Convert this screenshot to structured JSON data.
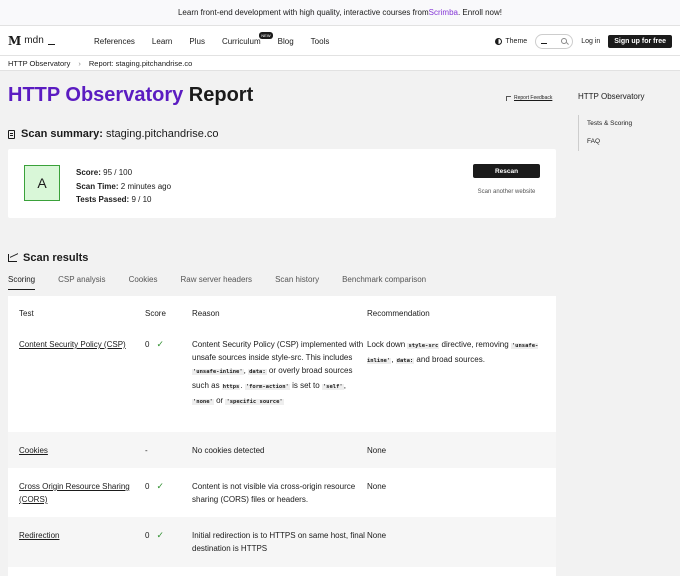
{
  "banner": {
    "prefix": "Learn front-end development with high quality, interactive courses from ",
    "link": "Scrimba",
    "suffix": ". Enroll now!"
  },
  "nav": {
    "logo": {
      "mark": "M",
      "text": "mdn"
    },
    "items": [
      "References",
      "Learn",
      "Plus",
      "Curriculum",
      "Blog",
      "Tools"
    ],
    "new_badge": "NEW",
    "theme": "Theme",
    "login": "Log in",
    "signup": "Sign up for free"
  },
  "breadcrumb": {
    "first": "HTTP Observatory",
    "second": "Report: staging.pitchandrise.co"
  },
  "page": {
    "title_accent": "HTTP Observatory",
    "title_rest": " Report",
    "report_feedback": "Report Feedback"
  },
  "summary": {
    "heading": "Scan summary:",
    "host": "staging.pitchandrise.co",
    "grade": "A",
    "score_label": "Score:",
    "score_value": "95 / 100",
    "time_label": "Scan Time:",
    "time_value": "2 minutes ago",
    "tests_label": "Tests Passed:",
    "tests_value": "9 / 10",
    "rescan": "Rescan",
    "scan_another": "Scan another website"
  },
  "results": {
    "heading": "Scan results",
    "tabs": [
      "Scoring",
      "CSP analysis",
      "Cookies",
      "Raw server headers",
      "Scan history",
      "Benchmark comparison"
    ],
    "columns": [
      "Test",
      "Score",
      "Reason",
      "Recommendation"
    ],
    "rows": [
      {
        "test": "Content Security Policy (CSP)",
        "score": "0"
      },
      {
        "test": "Cookies",
        "score": "-",
        "reason": "No cookies detected",
        "rec": "None"
      },
      {
        "test": "Cross Origin Resource Sharing (CORS)",
        "score": "0",
        "reason": "Content is not visible via cross-origin resource sharing (CORS) files or headers.",
        "rec": "None"
      },
      {
        "test": "Redirection",
        "score": "0",
        "reason": "Initial redirection is to HTTPS on same host, final destination is HTTPS",
        "rec": "None"
      }
    ],
    "csp_reason": {
      "t1": "Content Security Policy (CSP) implemented with unsafe sources inside style-src. This includes ",
      "c1": "'unsafe-inline'",
      "t2": ", ",
      "c2": "data:",
      "t3": " or overly broad sources such as ",
      "c3": "https",
      "t4": ". ",
      "c4": "'form-action'",
      "t5": " is set to ",
      "c5": "'self'",
      "t6": ", ",
      "c6": "'none'",
      "t7": " or ",
      "c7": "'specific source'"
    },
    "csp_rec": {
      "t1": "Lock down ",
      "c1": "style-src",
      "t2": " directive, removing ",
      "c2": "'unsafe-inline'",
      "t3": ", ",
      "c3": "data:",
      "t4": " and broad sources."
    }
  },
  "sidebar": {
    "title": "HTTP Observatory",
    "links": [
      "Tests & Scoring",
      "FAQ"
    ]
  },
  "colors": {
    "accent": "#5b1cc1",
    "link": "#8436d6",
    "grade_bg": "#d9f7d8",
    "check": "#2f8f2f"
  }
}
